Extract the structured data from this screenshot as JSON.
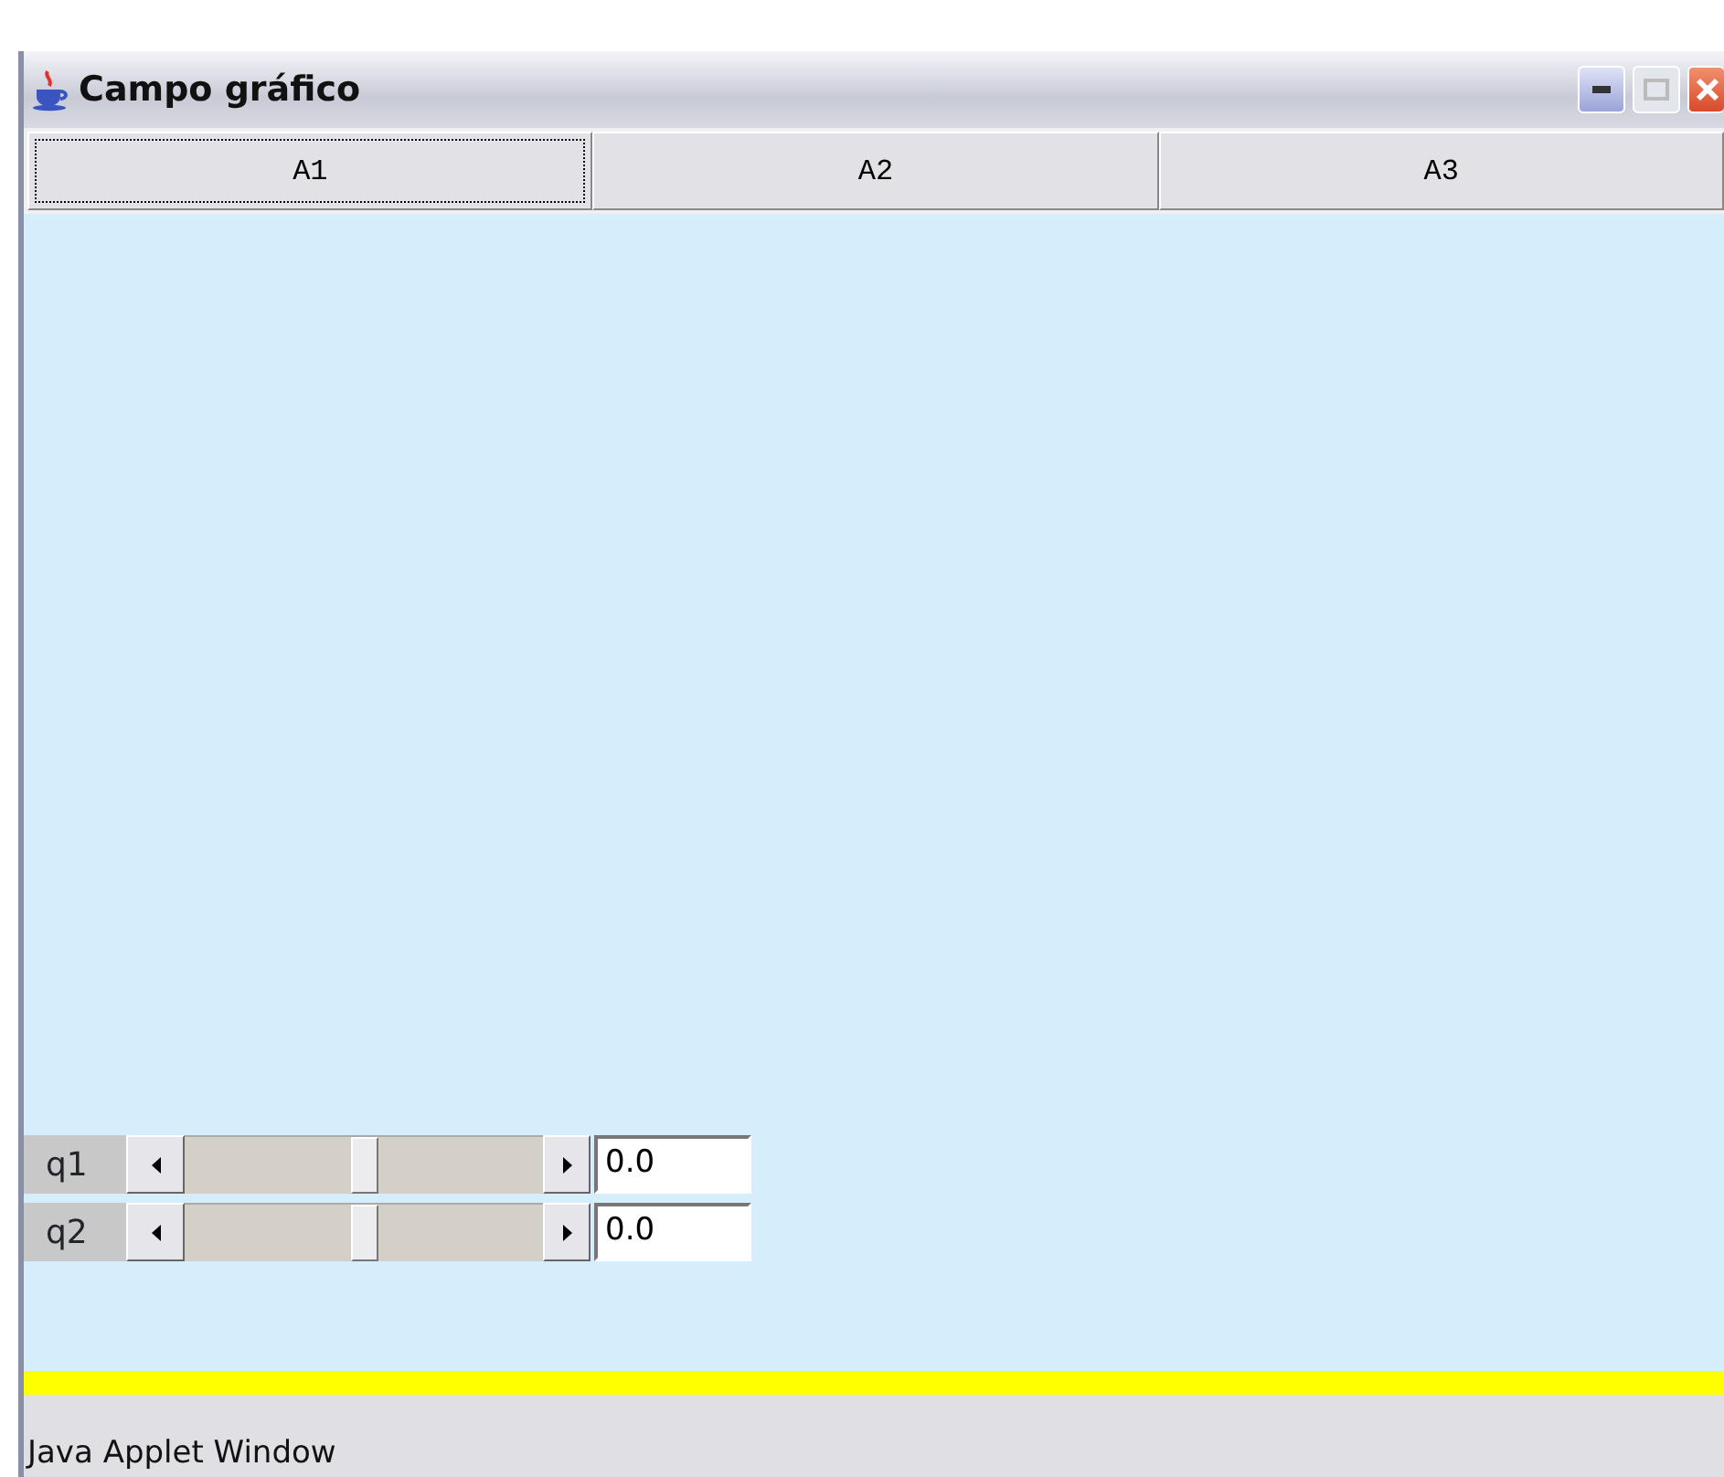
{
  "window": {
    "title": "Campo gráfico"
  },
  "buttons": [
    {
      "label": "A1",
      "focused": true
    },
    {
      "label": "A2",
      "focused": false
    },
    {
      "label": "A3",
      "focused": false
    }
  ],
  "sliders": [
    {
      "label": "q1",
      "value": "0.0"
    },
    {
      "label": "q2",
      "value": "0.0"
    }
  ],
  "status_bar": "Java Applet Window"
}
